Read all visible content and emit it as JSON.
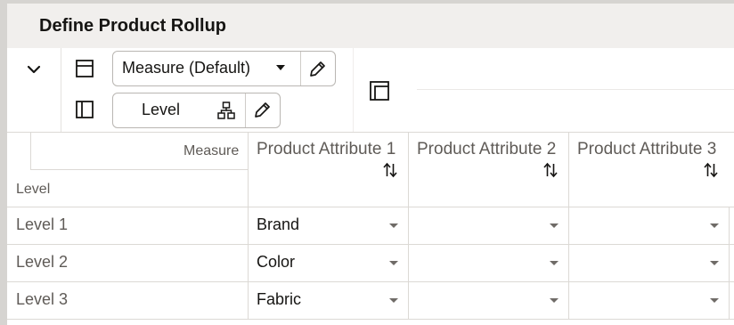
{
  "title": "Define Product Rollup",
  "toolbar": {
    "columns_field": {
      "label": "Measure (Default)"
    },
    "rows_field": {
      "label": "Level"
    }
  },
  "icons": {
    "collapse": "chevron-down-icon",
    "columns_layout": "column-layout-icon",
    "rows_layout": "row-layout-icon",
    "edit": "pencil-icon",
    "hierarchy": "hierarchy-icon",
    "pivot_corner": "pivot-corner-icon",
    "sort": "sort-arrows-icon",
    "dropdown": "caret-down-icon"
  },
  "grid": {
    "corner_column_header": "Measure",
    "corner_row_header": "Level",
    "columns": [
      "Product Attribute 1",
      "Product Attribute 2",
      "Product Attribute 3"
    ],
    "rows": [
      {
        "label": "Level 1",
        "values": [
          "Brand",
          "",
          ""
        ]
      },
      {
        "label": "Level 2",
        "values": [
          "Color",
          "",
          ""
        ]
      },
      {
        "label": "Level 3",
        "values": [
          "Fabric",
          "",
          ""
        ]
      }
    ]
  },
  "colors": {
    "title_bar": "#f1efed",
    "text": "#161513",
    "muted_text": "#5f5b57",
    "border": "#dcd9d5"
  }
}
